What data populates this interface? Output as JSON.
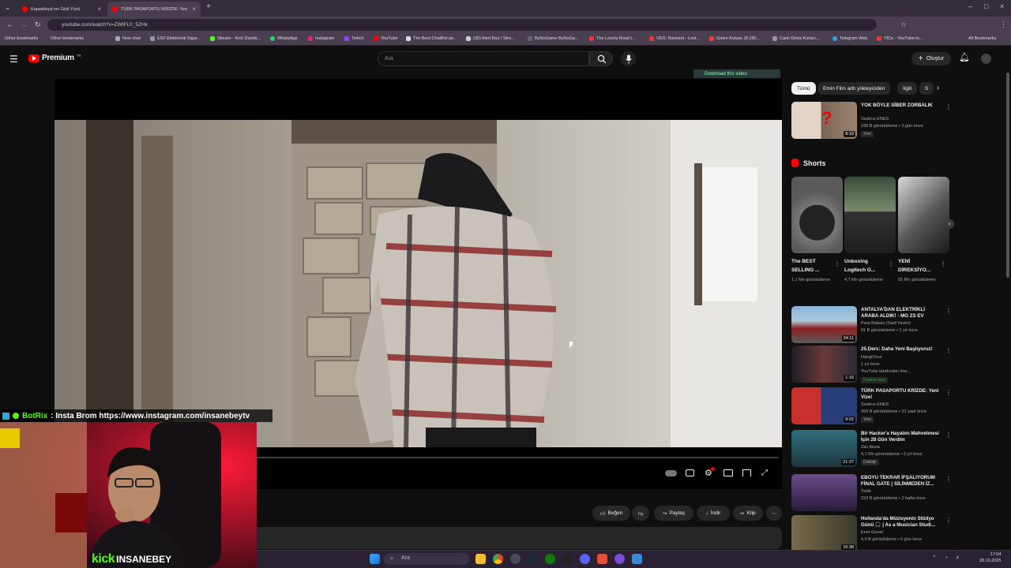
{
  "browser": {
    "tabs": [
      {
        "label": "Kapadokya'nın Gizli Yüzü"
      },
      {
        "label": "TÜRK PASAPORTU KRİZDE: Yen"
      }
    ],
    "url": "youtube.com/watch?v=ZWIFL0_5ZHk",
    "bookmarks": [
      "Other bookmarks",
      "Other bookmarks",
      "New chat",
      "ESF Elektronik Sigar...",
      "Stream - Kick Dashb...",
      "WhatsApp",
      "Instagram",
      "Twitch",
      "YouTube",
      "The Best ChatBot an...",
      "(30) Alert Box / Stre...",
      "ByNoGame ByNoGa...",
      "The Lonely Road |...",
      "VEO, Nanvent - Lost...",
      "Gelen Kutusu (8.185...",
      "Canlı Döviz Kurları,...",
      "Telegram Web",
      "YIOs - YouTube to...",
      "All Bookmarks"
    ]
  },
  "youtube": {
    "logo": "Premium",
    "logo_sup": "TR",
    "search_placeholder": "Ara",
    "create_label": "Oluştur",
    "download_banner": "Download this video"
  },
  "actions": {
    "like": "Beğen",
    "share": "Paylaş",
    "download": "İndir",
    "clip": "Klip"
  },
  "chips": [
    "Tümü",
    "Emin Film adlı yükleyiciden",
    "İlgili",
    "S"
  ],
  "shorts_heading": "Shorts",
  "sidebar_top": {
    "title": "YOK BÖYLE SİBER ZORBALIK",
    "channel": "Sadece ENES",
    "meta": "248 B görüntüleme • 2 gün önce",
    "badge": "Yeni",
    "duration": "8:10"
  },
  "shorts": [
    {
      "title": "The BEST SELLING ...",
      "views": "1,1 Mn görüntüleme"
    },
    {
      "title": "Unboxing Logitech G...",
      "views": "4,7 Mn görüntüleme"
    },
    {
      "title": "YENİ DİREKSİYO...",
      "views": "55 Mn görüntüleme"
    }
  ],
  "videos": [
    {
      "title": "ANTALYA'DAN ELEKTRİKLİ ARABA ALDIK! - MG ZS EV",
      "channel": "Para Babası (Said Yavim)",
      "meta": "91 B görüntüleme • 1 yıl önce",
      "duration": "34:11",
      "badge": ""
    },
    {
      "title": "25.Ders: Daha Yeni Başlıyoruz!",
      "channel": "HangiOnur",
      "meta": "1 yıl önce",
      "duration": "1:16",
      "badge": "Üyelere özel"
    },
    {
      "title": "TÜRK PASAPORTU KRİZDE: Yeni Vize!",
      "channel": "Sadece ENES",
      "meta": "269 B görüntüleme • 21 saat önce",
      "duration": "8:02",
      "badge": "Yeni"
    },
    {
      "title": "Bir Hacker'a Hayatını Mahvetmesi İçin 28 Gün Verdim",
      "channel": "Zac Aissa",
      "meta": "4,1 Mn görüntüleme • 2 yıl önce",
      "duration": "21:37",
      "badge": "Dublajlı"
    },
    {
      "title": "EBOYU TEKRAR İFŞALIYORUM FİNAL GATE ( SİLİNMEDEN İZ...",
      "channel": "Tanik",
      "meta": "233 B görüntüleme • 2 hafta önce",
      "duration": "",
      "badge": ""
    },
    {
      "title": "Hollanda'da Müzisyenin Stüdyo Günü 🎧 | As a Musician Studi...",
      "channel": "Eren Gunal",
      "meta": "4,6 B görüntüleme • 5 gün önce",
      "duration": "16:38",
      "badge": ""
    }
  ],
  "video2_extra": "YouTube tarafından öne...",
  "overlay": {
    "bot": "BotRix",
    "message": ": Insta Brom https://www.instagram.com/insanebeytv",
    "watermark_kick": "kick",
    "watermark_name": "INSANEBEY"
  },
  "taskbar": {
    "search": "Ara",
    "time": "17:04",
    "date": "28.10.2025"
  },
  "colors": {
    "youtube_red": "#ff0000",
    "kick_green": "#53fc18",
    "browser_frame": "#4a3f51"
  }
}
